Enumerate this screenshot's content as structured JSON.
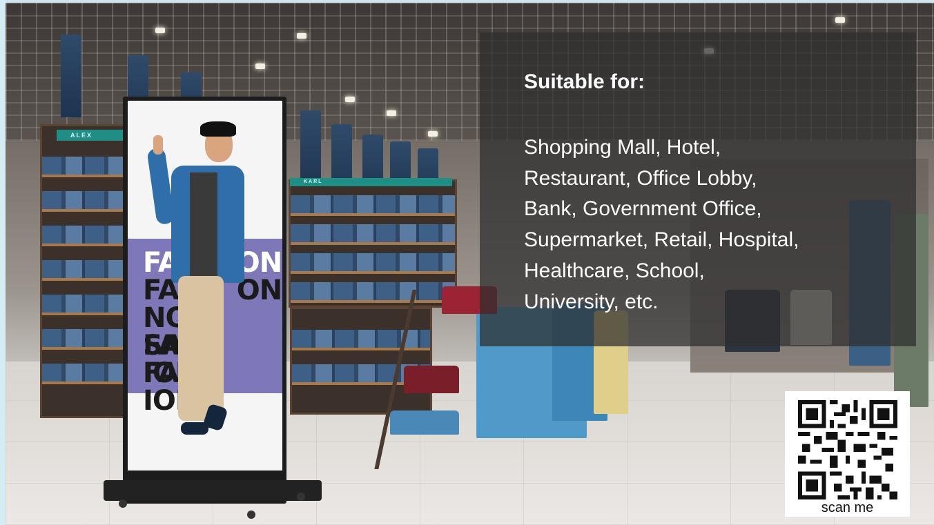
{
  "overlay": {
    "heading": "Suitable for:",
    "lines": [
      "Shopping Mall, Hotel,",
      "Restaurant, Office Lobby,",
      "Bank, Government Office,",
      "Supermarket, Retail, Hospital,",
      "Healthcare, School,",
      "University, etc."
    ]
  },
  "qr": {
    "caption": "scan me"
  },
  "poster": {
    "words": [
      "FA",
      "ON",
      "FA",
      "ON",
      "NO",
      "SAF",
      "FA",
      "ION",
      "FA",
      "ION"
    ]
  },
  "store_signs": {
    "alex": "ALEX",
    "karl": "KARL"
  },
  "colors": {
    "overlay_bg": "#2e2e2e",
    "poster_band": "#7f78b8",
    "shelf_sign": "#1f8f86"
  }
}
